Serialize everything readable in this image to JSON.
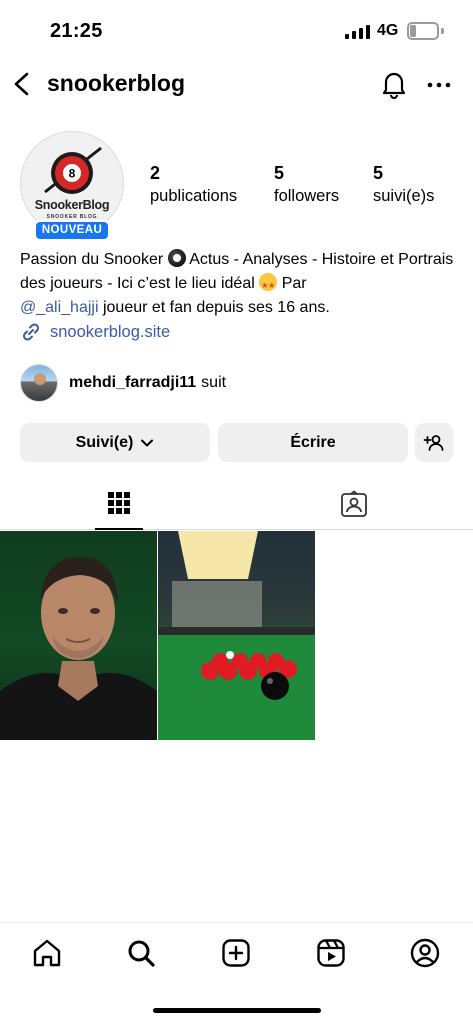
{
  "status_bar": {
    "time": "21:25",
    "network": "4G",
    "battery_level": "21"
  },
  "header": {
    "username": "snookerblog",
    "icons": [
      "chevron-left-icon",
      "bell-icon",
      "more-horizontal-icon"
    ]
  },
  "profile": {
    "avatar_logo_text": "SnookerBlog",
    "avatar_logo_subtext": "SNOOKER BLOG",
    "avatar_ball_number": "8",
    "badge": "NOUVEAU",
    "stats": [
      {
        "value": "2",
        "label": "publications"
      },
      {
        "value": "5",
        "label": "followers"
      },
      {
        "value": "5",
        "label": "suivi(e)s"
      }
    ],
    "bio": {
      "part1": "Passion du Snooker",
      "part2": "Actus - Analyses - Histoire et Portrais des joueurs - Ici c’est le lieu idéal",
      "part3": "Par",
      "mention": "@_ali_hajji",
      "part4": "joueur et fan depuis ses 16 ans."
    },
    "link": "snookerblog.site",
    "followed_by": {
      "username": "mehdi_farradji11",
      "suffix": "suit"
    }
  },
  "actions": {
    "follow_label": "Suivi(e)",
    "message_label": "Écrire"
  },
  "tabs": [
    "grid-icon",
    "tagged-icon"
  ],
  "posts": [
    {
      "name": "portrait-photo"
    },
    {
      "name": "snooker-table-photo"
    }
  ],
  "bottom_nav": [
    "home-icon",
    "search-icon",
    "create-icon",
    "reels-icon",
    "profile-icon"
  ],
  "colors": {
    "badge": "#1677f0",
    "link": "#3b5aa8",
    "button_bg": "#efefef"
  }
}
